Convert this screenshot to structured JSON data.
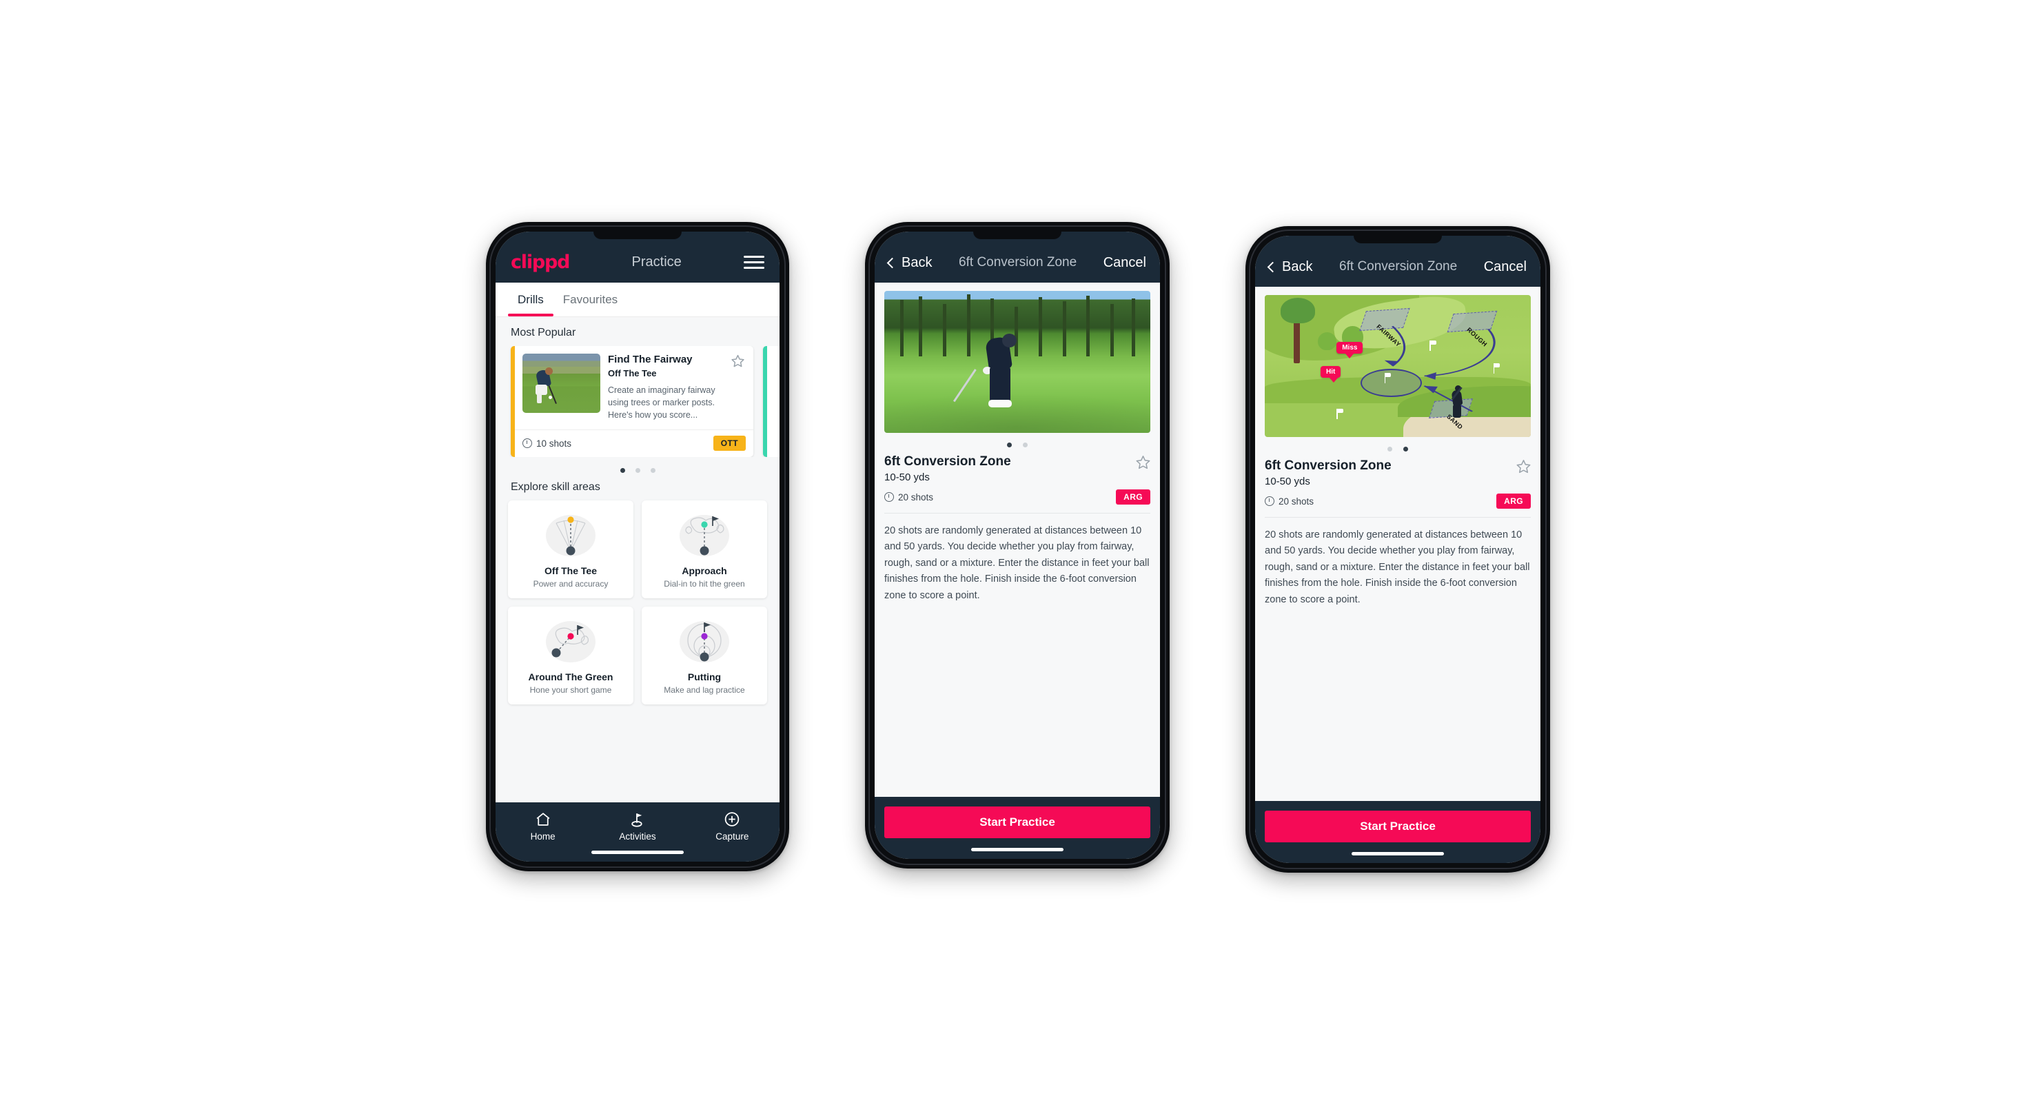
{
  "colors": {
    "brand_pink": "#f50a56",
    "navy": "#1b2a38",
    "amber": "#f7b319",
    "teal": "#3ad6ae",
    "page_bg": "#ffffff"
  },
  "screen1": {
    "appbar": {
      "logo": "clippd",
      "title": "Practice",
      "menu_icon": "hamburger-menu-icon"
    },
    "tabs": [
      {
        "label": "Drills",
        "active": true
      },
      {
        "label": "Favourites",
        "active": false
      }
    ],
    "most_popular": {
      "section_title": "Most Popular",
      "card": {
        "title": "Find The Fairway",
        "subtitle": "Off The Tee",
        "description": "Create an imaginary fairway using trees or marker posts. Here's how you score...",
        "shots": "10 shots",
        "badge": "OTT",
        "accent": "#f7b319",
        "favourite_icon": "star-outline-icon",
        "shots_icon": "clock-icon"
      },
      "next_card_accent": "#3ad6ae",
      "dots": {
        "count": 3,
        "active_index": 0
      }
    },
    "skills": {
      "section_title": "Explore skill areas",
      "items": [
        {
          "name": "Off The Tee",
          "desc": "Power and accuracy",
          "icon": "tee-shot-dispersion-icon",
          "dot_color": "#f7b319"
        },
        {
          "name": "Approach",
          "desc": "Dial-in to hit the green",
          "icon": "approach-green-icon",
          "dot_color": "#3ad6ae"
        },
        {
          "name": "Around The Green",
          "desc": "Hone your short game",
          "icon": "chip-to-green-icon",
          "dot_color": "#f50a56"
        },
        {
          "name": "Putting",
          "desc": "Make and lag practice",
          "icon": "putting-rings-icon",
          "dot_color": "#9b27d4"
        }
      ]
    },
    "tabbar": [
      {
        "label": "Home",
        "icon": "home-icon",
        "active": false
      },
      {
        "label": "Activities",
        "icon": "golf-flag-icon",
        "active": true
      },
      {
        "label": "Capture",
        "icon": "plus-circle-icon",
        "active": false
      }
    ]
  },
  "screen2": {
    "navbar": {
      "back": "Back",
      "title": "6ft Conversion Zone",
      "cancel": "Cancel",
      "back_icon": "chevron-left-icon"
    },
    "hero": {
      "type": "photo",
      "alt": "golfer chipping onto green"
    },
    "dots": {
      "count": 2,
      "active_index": 0
    },
    "detail": {
      "title": "6ft Conversion Zone",
      "yards": "10-50 yds",
      "shots": "20 shots",
      "badge": "ARG",
      "favourite_icon": "star-outline-icon",
      "shots_icon": "clock-icon",
      "description": "20 shots are randomly generated at distances between 10 and 50 yards. You decide whether you play from fairway, rough, sand or a mixture. Enter the distance in feet your ball finishes from the hole. Finish inside the 6-foot conversion zone to score a point."
    },
    "cta": "Start Practice"
  },
  "screen3": {
    "navbar": {
      "back": "Back",
      "title": "6ft Conversion Zone",
      "cancel": "Cancel",
      "back_icon": "chevron-left-icon"
    },
    "hero": {
      "type": "diagram",
      "alt": "illustrated golf hole showing lie zones",
      "zone_labels": [
        "FAIRWAY",
        "ROUGH",
        "SAND"
      ],
      "callouts": [
        "Miss",
        "Hit"
      ]
    },
    "dots": {
      "count": 2,
      "active_index": 1
    },
    "detail": {
      "title": "6ft Conversion Zone",
      "yards": "10-50 yds",
      "shots": "20 shots",
      "badge": "ARG",
      "favourite_icon": "star-outline-icon",
      "shots_icon": "clock-icon",
      "description": "20 shots are randomly generated at distances between 10 and 50 yards. You decide whether you play from fairway, rough, sand or a mixture. Enter the distance in feet your ball finishes from the hole. Finish inside the 6-foot conversion zone to score a point."
    },
    "cta": "Start Practice"
  }
}
